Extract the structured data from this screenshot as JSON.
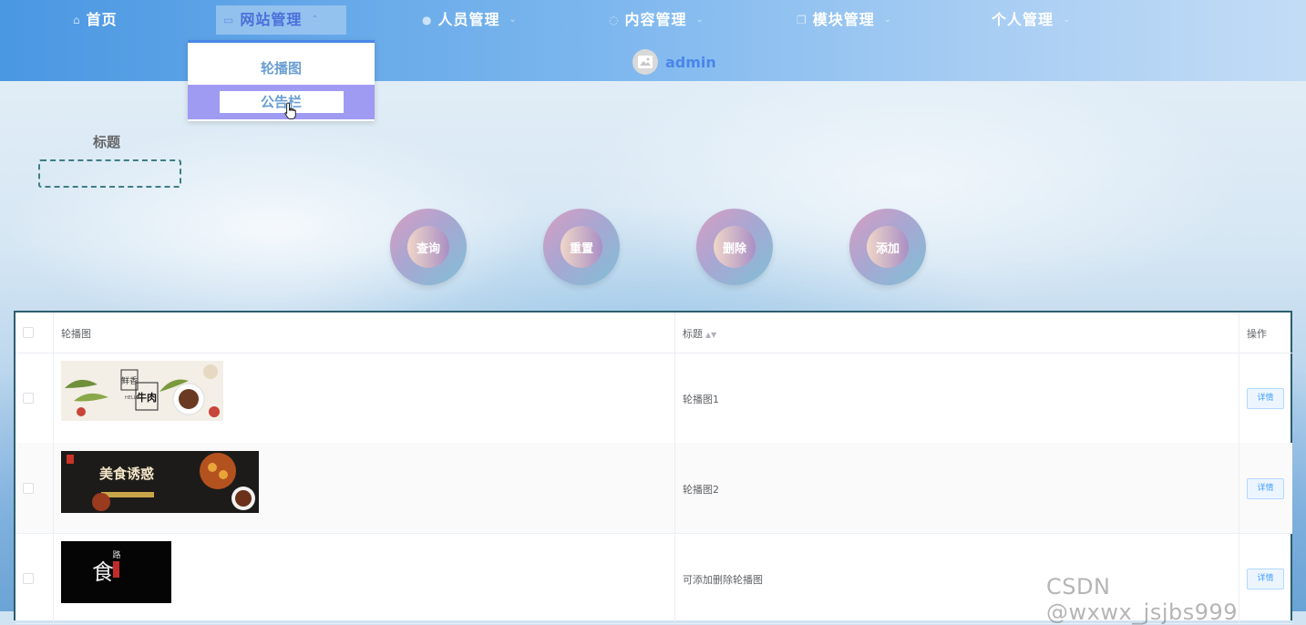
{
  "nav": {
    "items": [
      {
        "label": "首页",
        "icon": "home-icon"
      },
      {
        "label": "网站管理",
        "icon": "monitor-icon"
      },
      {
        "label": "人员管理",
        "icon": "user-icon"
      },
      {
        "label": "内容管理",
        "icon": "message-icon"
      },
      {
        "label": "模块管理",
        "icon": "copy-icon"
      },
      {
        "label": "个人管理",
        "icon": ""
      }
    ],
    "active_index": 1,
    "user": "admin",
    "dropdown": [
      "轮播图",
      "公告栏"
    ]
  },
  "search": {
    "label": "标题",
    "value": ""
  },
  "buttons": {
    "query": "查询",
    "reset": "重置",
    "delete": "删除",
    "add": "添加"
  },
  "table": {
    "headers": [
      "轮播图",
      "标题",
      "操作"
    ],
    "rows": [
      {
        "title": "轮播图1",
        "action": "详情",
        "image_text": [
          "鲜香",
          "牛肉",
          "HELLO"
        ]
      },
      {
        "title": "轮播图2",
        "action": "详情",
        "image_text": [
          "美食诱惑"
        ]
      },
      {
        "title": "可添加删除轮播图",
        "action": "详情",
        "image_text": [
          "食",
          "路"
        ]
      }
    ]
  },
  "watermark": "CSDN @wxwx_jsjbs999",
  "colors": {
    "accent": "#4a86e8",
    "dropdown_highlight": "#9f9bf2",
    "table_border": "#2d5d6d"
  }
}
